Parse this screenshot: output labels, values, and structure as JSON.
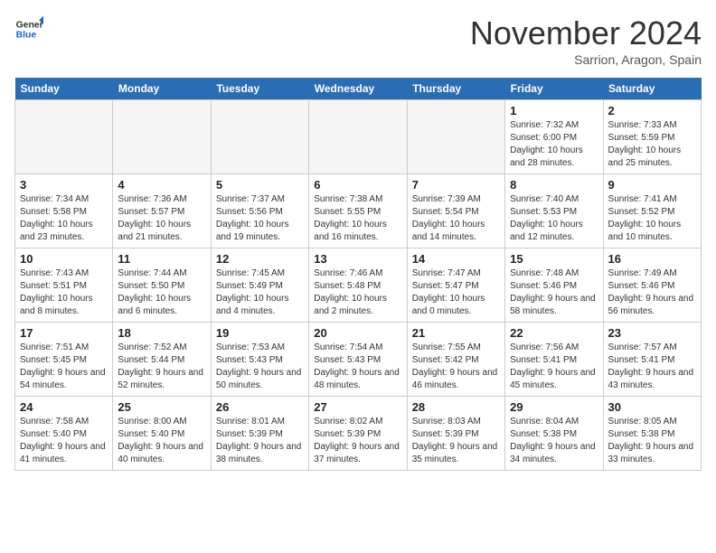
{
  "header": {
    "logo": {
      "general": "General",
      "blue": "Blue"
    },
    "month": "November 2024",
    "location": "Sarrion, Aragon, Spain"
  },
  "weekdays": [
    "Sunday",
    "Monday",
    "Tuesday",
    "Wednesday",
    "Thursday",
    "Friday",
    "Saturday"
  ],
  "weeks": [
    [
      {
        "day": "",
        "info": ""
      },
      {
        "day": "",
        "info": ""
      },
      {
        "day": "",
        "info": ""
      },
      {
        "day": "",
        "info": ""
      },
      {
        "day": "",
        "info": ""
      },
      {
        "day": "1",
        "info": "Sunrise: 7:32 AM\nSunset: 6:00 PM\nDaylight: 10 hours and 28 minutes."
      },
      {
        "day": "2",
        "info": "Sunrise: 7:33 AM\nSunset: 5:59 PM\nDaylight: 10 hours and 25 minutes."
      }
    ],
    [
      {
        "day": "3",
        "info": "Sunrise: 7:34 AM\nSunset: 5:58 PM\nDaylight: 10 hours and 23 minutes."
      },
      {
        "day": "4",
        "info": "Sunrise: 7:36 AM\nSunset: 5:57 PM\nDaylight: 10 hours and 21 minutes."
      },
      {
        "day": "5",
        "info": "Sunrise: 7:37 AM\nSunset: 5:56 PM\nDaylight: 10 hours and 19 minutes."
      },
      {
        "day": "6",
        "info": "Sunrise: 7:38 AM\nSunset: 5:55 PM\nDaylight: 10 hours and 16 minutes."
      },
      {
        "day": "7",
        "info": "Sunrise: 7:39 AM\nSunset: 5:54 PM\nDaylight: 10 hours and 14 minutes."
      },
      {
        "day": "8",
        "info": "Sunrise: 7:40 AM\nSunset: 5:53 PM\nDaylight: 10 hours and 12 minutes."
      },
      {
        "day": "9",
        "info": "Sunrise: 7:41 AM\nSunset: 5:52 PM\nDaylight: 10 hours and 10 minutes."
      }
    ],
    [
      {
        "day": "10",
        "info": "Sunrise: 7:43 AM\nSunset: 5:51 PM\nDaylight: 10 hours and 8 minutes."
      },
      {
        "day": "11",
        "info": "Sunrise: 7:44 AM\nSunset: 5:50 PM\nDaylight: 10 hours and 6 minutes."
      },
      {
        "day": "12",
        "info": "Sunrise: 7:45 AM\nSunset: 5:49 PM\nDaylight: 10 hours and 4 minutes."
      },
      {
        "day": "13",
        "info": "Sunrise: 7:46 AM\nSunset: 5:48 PM\nDaylight: 10 hours and 2 minutes."
      },
      {
        "day": "14",
        "info": "Sunrise: 7:47 AM\nSunset: 5:47 PM\nDaylight: 10 hours and 0 minutes."
      },
      {
        "day": "15",
        "info": "Sunrise: 7:48 AM\nSunset: 5:46 PM\nDaylight: 9 hours and 58 minutes."
      },
      {
        "day": "16",
        "info": "Sunrise: 7:49 AM\nSunset: 5:46 PM\nDaylight: 9 hours and 56 minutes."
      }
    ],
    [
      {
        "day": "17",
        "info": "Sunrise: 7:51 AM\nSunset: 5:45 PM\nDaylight: 9 hours and 54 minutes."
      },
      {
        "day": "18",
        "info": "Sunrise: 7:52 AM\nSunset: 5:44 PM\nDaylight: 9 hours and 52 minutes."
      },
      {
        "day": "19",
        "info": "Sunrise: 7:53 AM\nSunset: 5:43 PM\nDaylight: 9 hours and 50 minutes."
      },
      {
        "day": "20",
        "info": "Sunrise: 7:54 AM\nSunset: 5:43 PM\nDaylight: 9 hours and 48 minutes."
      },
      {
        "day": "21",
        "info": "Sunrise: 7:55 AM\nSunset: 5:42 PM\nDaylight: 9 hours and 46 minutes."
      },
      {
        "day": "22",
        "info": "Sunrise: 7:56 AM\nSunset: 5:41 PM\nDaylight: 9 hours and 45 minutes."
      },
      {
        "day": "23",
        "info": "Sunrise: 7:57 AM\nSunset: 5:41 PM\nDaylight: 9 hours and 43 minutes."
      }
    ],
    [
      {
        "day": "24",
        "info": "Sunrise: 7:58 AM\nSunset: 5:40 PM\nDaylight: 9 hours and 41 minutes."
      },
      {
        "day": "25",
        "info": "Sunrise: 8:00 AM\nSunset: 5:40 PM\nDaylight: 9 hours and 40 minutes."
      },
      {
        "day": "26",
        "info": "Sunrise: 8:01 AM\nSunset: 5:39 PM\nDaylight: 9 hours and 38 minutes."
      },
      {
        "day": "27",
        "info": "Sunrise: 8:02 AM\nSunset: 5:39 PM\nDaylight: 9 hours and 37 minutes."
      },
      {
        "day": "28",
        "info": "Sunrise: 8:03 AM\nSunset: 5:39 PM\nDaylight: 9 hours and 35 minutes."
      },
      {
        "day": "29",
        "info": "Sunrise: 8:04 AM\nSunset: 5:38 PM\nDaylight: 9 hours and 34 minutes."
      },
      {
        "day": "30",
        "info": "Sunrise: 8:05 AM\nSunset: 5:38 PM\nDaylight: 9 hours and 33 minutes."
      }
    ]
  ]
}
